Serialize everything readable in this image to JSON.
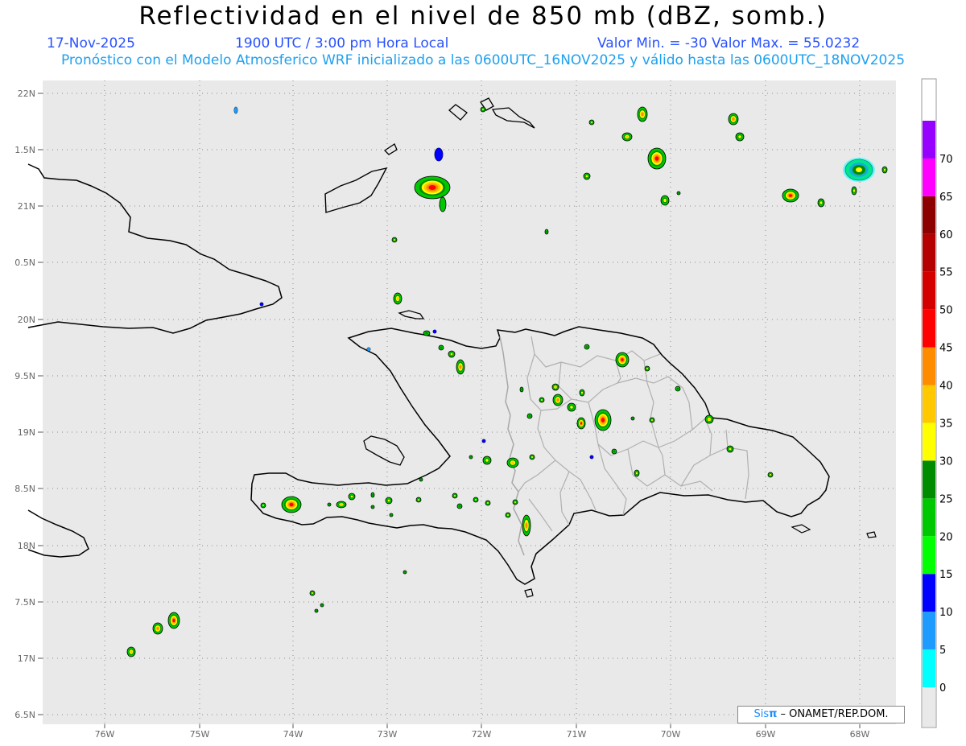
{
  "header": {
    "title": "Reflectividad en el nivel de 850 mb (dBZ, somb.)",
    "date": "17-Nov-2025",
    "time": "1900 UTC / 3:00 pm Hora Local",
    "minmax": "Valor Min. = -30  Valor Max. = 55.0232",
    "forecast": "Pronóstico con el Modelo Atmosferico WRF inicializado a las 0600UTC_16NOV2025 y válido hasta las  0600UTC_18NOV2025"
  },
  "map": {
    "lon_range": [
      -76.7,
      -67.6
    ],
    "lat_range": [
      6.37,
      7.2
    ],
    "lat_ticks": [
      "22N",
      "1.5N",
      "21N",
      "0.5N",
      "20N",
      "9.5N",
      "19N",
      "8.5N",
      "18N",
      "7.5N",
      "17N",
      "6.5N"
    ],
    "lon_ticks": [
      "76W",
      "75W",
      "74W",
      "73W",
      "72W",
      "71W",
      "70W",
      "69W",
      "68W"
    ],
    "colors": {
      "background": "#e9e9e9",
      "coast": "#000000",
      "border": "#a8a8a8",
      "grid": "#8a8a8a"
    }
  },
  "colorbar": {
    "labels": [
      "0",
      "5",
      "10",
      "15",
      "20",
      "25",
      "30",
      "35",
      "40",
      "45",
      "50",
      "55",
      "60",
      "65",
      "70"
    ],
    "colors": [
      "#00ffff",
      "#1e9bff",
      "#0000ff",
      "#00ff00",
      "#00c800",
      "#008c00",
      "#ffff00",
      "#ffc800",
      "#ff8c00",
      "#ff0000",
      "#d40000",
      "#b40000",
      "#8c0000",
      "#ff00ff",
      "#9600ff"
    ]
  },
  "credit": {
    "sis": "Sis",
    "pi": "π",
    "text": " – ONAMET/REP.DOM."
  }
}
